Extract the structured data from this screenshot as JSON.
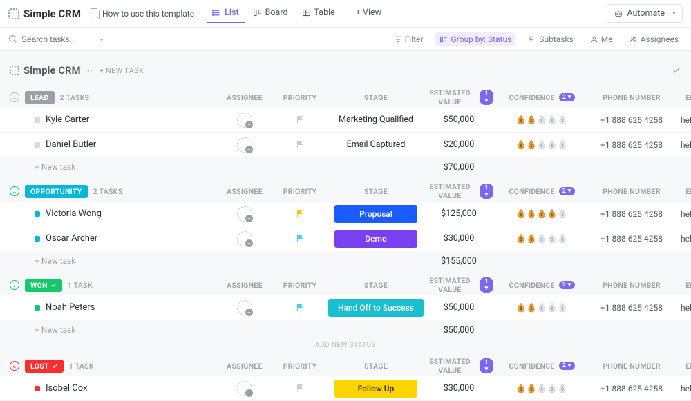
{
  "header": {
    "workspace": "Simple CRM",
    "template_link": "How to use this template",
    "views": [
      {
        "label": "List",
        "active": true
      },
      {
        "label": "Board",
        "active": false
      },
      {
        "label": "Table",
        "active": false
      }
    ],
    "add_view": "+ View",
    "automate": "Automate"
  },
  "filterbar": {
    "search_placeholder": "Search tasks...",
    "filter": "Filter",
    "groupby": "Group by: Status",
    "subtasks": "Subtasks",
    "me": "Me",
    "assignees": "Assignees"
  },
  "section": {
    "title": "Simple CRM",
    "new_task": "+ NEW TASK"
  },
  "columns": {
    "assignee": "ASSIGNEE",
    "priority": "PRIORITY",
    "stage": "STAGE",
    "est_value": "ESTIMATED VALUE",
    "est_value_badge": "1 ▾",
    "confidence": "CONFIDENCE",
    "confidence_badge": "2 ▾",
    "phone": "PHONE NUMBER",
    "email": "EMAIL ADDRESS"
  },
  "groups": [
    {
      "id": "lead",
      "label": "LEAD",
      "color": "#9aa0a6",
      "toggle_color": "#b8bbc0",
      "show_check": false,
      "count": "2 TASKS",
      "tasks": [
        {
          "name": "Kyle Carter",
          "dot": "#d8d8d8",
          "flag": "#c7cad0",
          "stage": "Marketing Qualified",
          "stage_bg": "",
          "value": "$50,000",
          "confidence": 2,
          "phone": "+1 888 625 4258",
          "email": "help@clickup.com"
        },
        {
          "name": "Daniel Butler",
          "dot": "#d8d8d8",
          "flag": "#c7cad0",
          "stage": "Email Captured",
          "stage_bg": "",
          "value": "$20,000",
          "confidence": 2,
          "phone": "+1 888 625 4258",
          "email": "help@clickup.com"
        }
      ],
      "total": "$70,000",
      "new_task": "+ New task"
    },
    {
      "id": "opportunity",
      "label": "OPPORTUNITY",
      "color": "#00b8d9",
      "toggle_color": "#00b8d9",
      "show_check": false,
      "count": "2 TASKS",
      "tasks": [
        {
          "name": "Victoria Wong",
          "dot": "#00b8d9",
          "flag": "#ffc400",
          "stage": "Proposal",
          "stage_bg": "#1a5cff",
          "value": "$125,000",
          "confidence": 4,
          "phone": "+1 888 625 4258",
          "email": "help@clickup.com"
        },
        {
          "name": "Oscar Archer",
          "dot": "#00b8d9",
          "flag": "#4cc9ff",
          "stage": "Demo",
          "stage_bg": "#7b3ff2",
          "value": "$30,000",
          "confidence": 2,
          "phone": "+1 888 625 4258",
          "email": "help@clickup.com"
        }
      ],
      "total": "$155,000",
      "new_task": "+ New task"
    },
    {
      "id": "won",
      "label": "WON",
      "color": "#14c76a",
      "toggle_color": "#14c76a",
      "show_check": true,
      "count": "1 TASK",
      "tasks": [
        {
          "name": "Noah Peters",
          "dot": "#14c76a",
          "flag": "#4cc9ff",
          "stage": "Hand Off to Success",
          "stage_bg": "#18bfcf",
          "value": "$50,000",
          "confidence": 2,
          "phone": "+1 888 625 4258",
          "email": "help@clickup.com"
        }
      ],
      "total": "$50,000",
      "new_task": "+ New task",
      "add_status": "ADD NEW STATUS"
    },
    {
      "id": "lost",
      "label": "LOST",
      "color": "#ff2e2e",
      "toggle_color": "#ff2e2e",
      "show_check": true,
      "count": "1 TASK",
      "tasks": [
        {
          "name": "Isobel Cox",
          "dot": "#ff2e2e",
          "flag": "#c7cad0",
          "stage": "Follow Up",
          "stage_bg": "#ffd500",
          "stage_text": "#292d34",
          "value": "$30,000",
          "confidence": 2,
          "phone": "+1 888 625 4258",
          "email": "help@clickup.com"
        }
      ],
      "total": "",
      "new_task": ""
    }
  ]
}
